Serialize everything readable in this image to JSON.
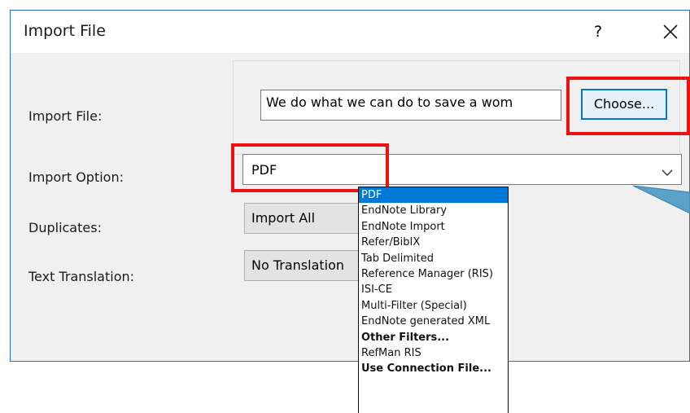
{
  "dialog": {
    "title": "Import File",
    "help_label": "?",
    "close_icon": "close-icon"
  },
  "form": {
    "import_file_label": "Import File:",
    "import_file_value": "We do what we can do to save a wom",
    "choose_label": "Choose...",
    "import_option_label": "Import Option:",
    "import_option_value": "PDF",
    "duplicates_label": "Duplicates:",
    "duplicates_value": "Import All",
    "text_translation_label": "Text Translation:",
    "text_translation_value": "No Translation"
  },
  "dropdown": {
    "options": [
      "PDF",
      "EndNote Library",
      "EndNote Import",
      "Refer/BibIX",
      "Tab Delimited",
      "Reference Manager (RIS)",
      "ISI-CE",
      "Multi-Filter (Special)",
      "EndNote generated XML",
      "Other Filters...",
      "RefMan RIS",
      "Use Connection File..."
    ]
  },
  "colors": {
    "highlight": "#ee1111",
    "selection": "#0078d7",
    "dialog_border": "#2b6ec9"
  }
}
